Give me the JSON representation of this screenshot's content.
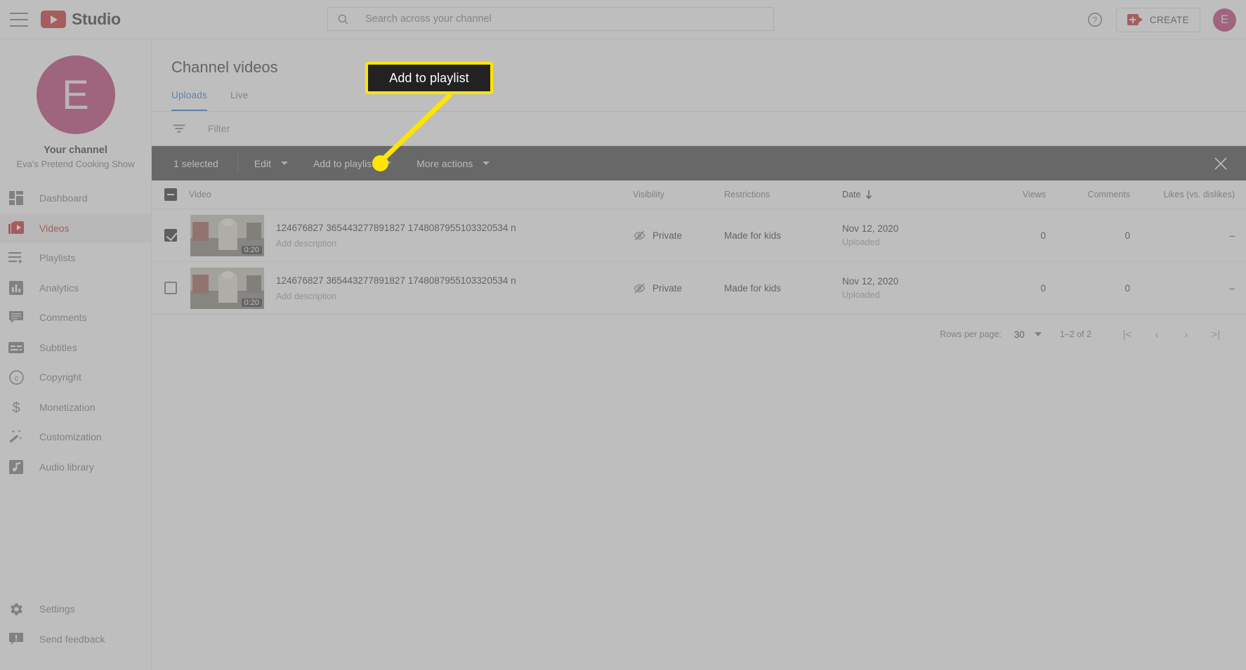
{
  "app": {
    "brand": "Studio",
    "hamburger_icon": "hamburger-menu-icon",
    "logo_icon": "youtube-logo-icon"
  },
  "search": {
    "placeholder": "Search across your channel",
    "value": "",
    "icon": "search-icon"
  },
  "header": {
    "help_icon": "help-circle-icon",
    "create_label": "CREATE",
    "create_icon": "video-camera-plus-icon",
    "avatar_initial": "E",
    "avatar_color": "#ad1457"
  },
  "sidebar": {
    "avatar_initial": "E",
    "your_channel_label": "Your channel",
    "channel_name": "Eva's Pretend Cooking Show",
    "items": [
      {
        "label": "Dashboard",
        "icon": "dashboard-icon",
        "active": false
      },
      {
        "label": "Videos",
        "icon": "videos-icon",
        "active": true
      },
      {
        "label": "Playlists",
        "icon": "playlists-icon",
        "active": false
      },
      {
        "label": "Analytics",
        "icon": "analytics-icon",
        "active": false
      },
      {
        "label": "Comments",
        "icon": "comments-icon",
        "active": false
      },
      {
        "label": "Subtitles",
        "icon": "subtitles-icon",
        "active": false
      },
      {
        "label": "Copyright",
        "icon": "copyright-icon",
        "active": false
      },
      {
        "label": "Monetization",
        "icon": "dollar-icon",
        "active": false
      },
      {
        "label": "Customization",
        "icon": "magic-wand-icon",
        "active": false
      },
      {
        "label": "Audio library",
        "icon": "audio-library-icon",
        "active": false
      }
    ],
    "bottom_items": [
      {
        "label": "Settings",
        "icon": "gear-icon"
      },
      {
        "label": "Send feedback",
        "icon": "feedback-icon"
      }
    ],
    "active_color": "#c00000"
  },
  "main": {
    "page_title": "Channel videos",
    "tabs": [
      {
        "label": "Uploads",
        "active": true
      },
      {
        "label": "Live",
        "active": false
      }
    ],
    "filter": {
      "icon": "filter-icon",
      "placeholder": "Filter",
      "value": ""
    }
  },
  "selection_toolbar": {
    "count_label": "1 selected",
    "buttons": [
      {
        "label": "Edit",
        "has_caret": true
      },
      {
        "label": "Add to playlist",
        "has_caret": true
      },
      {
        "label": "More actions",
        "has_caret": true
      }
    ],
    "close_icon": "close-icon",
    "background": "#1d1d1d"
  },
  "table": {
    "headers": {
      "video": "Video",
      "visibility": "Visibility",
      "restrictions": "Restrictions",
      "date": "Date",
      "date_sort_icon": "arrow-down-icon",
      "views": "Views",
      "comments": "Comments",
      "likes": "Likes (vs. dislikes)"
    },
    "header_checkbox_state": "indeterminate",
    "rows": [
      {
        "checked": true,
        "duration": "0:20",
        "title": "124676827 365443277891827 1748087955103320534 n",
        "description": "Add description",
        "visibility": "Private",
        "visibility_icon": "eye-off-icon",
        "restrictions": "Made for kids",
        "date": "Nov 12, 2020",
        "date_sub": "Uploaded",
        "views": "0",
        "comments": "0",
        "likes": "–"
      },
      {
        "checked": false,
        "duration": "0:20",
        "title": "124676827 365443277891827 1748087955103320534 n",
        "description": "Add description",
        "visibility": "Private",
        "visibility_icon": "eye-off-icon",
        "restrictions": "Made for kids",
        "date": "Nov 12, 2020",
        "date_sub": "Uploaded",
        "views": "0",
        "comments": "0",
        "likes": "–"
      }
    ]
  },
  "pagination": {
    "rows_per_page_label": "Rows per page:",
    "rows_per_page_value": "30",
    "range": "1–2 of 2",
    "first_icon": "|<",
    "prev_icon": "‹",
    "next_icon": "›",
    "last_icon": ">|"
  },
  "callout": {
    "text": "Add to playlist",
    "border_color": "#ffe500",
    "fill_color": "#222222",
    "text_color": "#ffffff"
  }
}
